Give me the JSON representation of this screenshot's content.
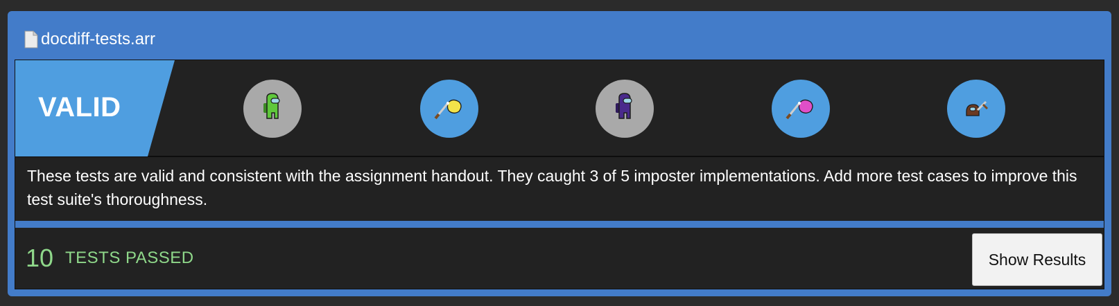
{
  "file": {
    "name": "docdiff-tests.arr",
    "icon": "document-icon"
  },
  "status": {
    "label": "VALID",
    "color": "#4f9ee0"
  },
  "impostors": [
    {
      "state": "safe",
      "crewmate_color": "#5fc83b",
      "icon": "green-crewmate-icon"
    },
    {
      "state": "caught",
      "crewmate_color": "#f3e34a",
      "icon": "yellow-crewmate-stabbed-icon"
    },
    {
      "state": "safe",
      "crewmate_color": "#4a2a8c",
      "icon": "purple-crewmate-icon"
    },
    {
      "state": "caught",
      "crewmate_color": "#e04fc8",
      "icon": "pink-crewmate-stabbed-icon"
    },
    {
      "state": "caught",
      "crewmate_color": "#6b3a22",
      "icon": "brown-crewmate-stabbed-icon"
    }
  ],
  "description": "These tests are valid and consistent with the assignment handout. They caught 3 of 5 imposter implementations. Add more test cases to improve this test suite's thoroughness.",
  "footer": {
    "count": "10",
    "label": "TESTS PASSED",
    "button_label": "Show Results"
  },
  "colors": {
    "frame": "#437cc9",
    "panel": "#222222",
    "pass_text": "#8fd88a",
    "caught_circle": "#4f9ee0",
    "safe_circle": "#a9a9a9"
  }
}
